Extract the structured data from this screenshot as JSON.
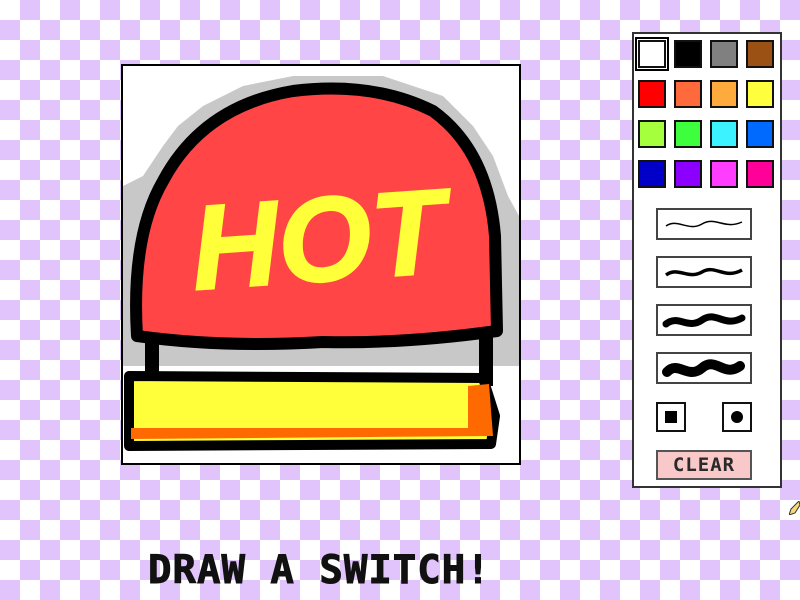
{
  "drawing": {
    "label_text": "HOT",
    "label_color": "#ffff3a",
    "dome_color": "#ff4545",
    "base_color": "#ffff3a",
    "base_accent_color": "#ff6a00",
    "backdrop_color": "#c8c8c8"
  },
  "palette": {
    "colors": [
      "#ffffff",
      "#000000",
      "#808080",
      "#9b5014",
      "#ff0000",
      "#ff6a3d",
      "#ffaa3d",
      "#ffff3d",
      "#a6ff3d",
      "#3dff3d",
      "#3df2ff",
      "#006aff",
      "#0000c8",
      "#8c00ff",
      "#ff3dff",
      "#ff0099"
    ],
    "selected_index": 0
  },
  "brush_sizes": [
    "thin",
    "medium",
    "thick",
    "extra-thick"
  ],
  "shape_options": [
    "square-brush-icon",
    "round-brush-icon"
  ],
  "controls": {
    "clear_label": "CLEAR"
  },
  "prompt": {
    "text": "DRAW A SWITCH!"
  }
}
